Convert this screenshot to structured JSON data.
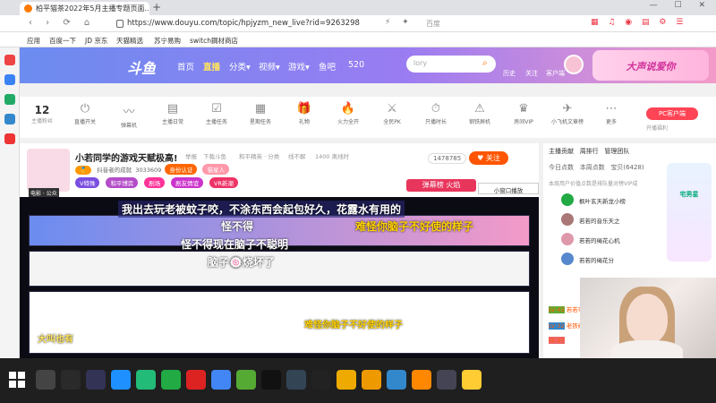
{
  "browser": {
    "tab_title": "柏平猫茶2022年5月主播专题页面...",
    "url": "https://www.douyu.com/topic/hpjyzm_new_live?rid=9263298",
    "search_engine": "百度",
    "bookmarks": [
      "应用",
      "百度一下",
      "JD 京东",
      "天猫精选",
      "苏宁易购",
      "switch鋼材商店"
    ]
  },
  "site": {
    "logo": "斗鱼",
    "nav": [
      "首页",
      "直播",
      "分类▾",
      "视频▾",
      "游戏▾",
      "鱼吧",
      "520"
    ],
    "search_placeholder": "lory",
    "user_icons": [
      "历史",
      "关注",
      "客户端"
    ],
    "banner": "大声说爱你"
  },
  "icon_row": {
    "stat_num": "12",
    "stat_label": "主播粉丝",
    "items": [
      "直播开关",
      "弹幕机",
      "主播日常",
      "主播任务",
      "星期任务",
      "礼物",
      "火力全开",
      "全民PK",
      "只播时长",
      "钢铁屏机",
      "房间VIP",
      "小飞机文章榜",
      "更多"
    ],
    "pc_button": "PC客户端",
    "pc_sub": "开播福利"
  },
  "stream": {
    "title": "小若同学的游戏天赋极高!",
    "meta": [
      "举报",
      "下载斗鱼",
      "和平精英 · 分类"
    ],
    "meta_right": [
      "线不解",
      "1400 离线时"
    ],
    "pfp_label": "电影 · 公众",
    "badge_text": "抖音者的成就",
    "room_id": "3033609",
    "badge_cert": "身份认证",
    "badge_other": "猫星人",
    "tags": [
      "V特殊",
      "和平博弈",
      "剧场",
      "剧友情谊",
      "VR新潮"
    ],
    "viewers": "1478785",
    "follow": "关注",
    "fire": "弹幕榜 火焰",
    "mini_player": "小窗口播放"
  },
  "danmaku": [
    {
      "text": "我出去玩老被蚊子咬，不涂东西会起包好久，花露水有用的",
      "color": "#ffffff"
    },
    {
      "text": "怪不得",
      "color": "#ffffff"
    },
    {
      "text": "难怪你脑子不好使的样子",
      "color": "#ffd200"
    },
    {
      "text": "怪不得现在脑子不聪明",
      "color": "#ffffff"
    },
    {
      "text": "脑子🍥烧坏了",
      "color": "#ffffff"
    },
    {
      "text": "大叫也有",
      "color": "#ffe45c"
    },
    {
      "text": "难怪你脑子不好使的样子",
      "color": "#ffd200"
    }
  ],
  "side": {
    "tabs": [
      "主播贡献",
      "周排行",
      "管理团队"
    ],
    "tabs2": [
      "今日点数",
      "本周点数",
      "宝贝(6428)"
    ],
    "note": "本周用户价值点数是排队量对榜VIP成",
    "ranks": [
      "枫叶玄天新龙小榜",
      "若若的音乐天之",
      "若若的绳花心机",
      "若若的绳花分"
    ],
    "promo": "宅男星",
    "levels": [
      "LV 43",
      "LV 32",
      "LV 27"
    ],
    "chat_lines": [
      "若若可以的~",
      "老铁给主播点赞"
    ]
  },
  "colors": {
    "header_start": "#6b8cf0",
    "header_end": "#f39ac8",
    "accent": "#ff5500",
    "fire": "#e8355c"
  }
}
